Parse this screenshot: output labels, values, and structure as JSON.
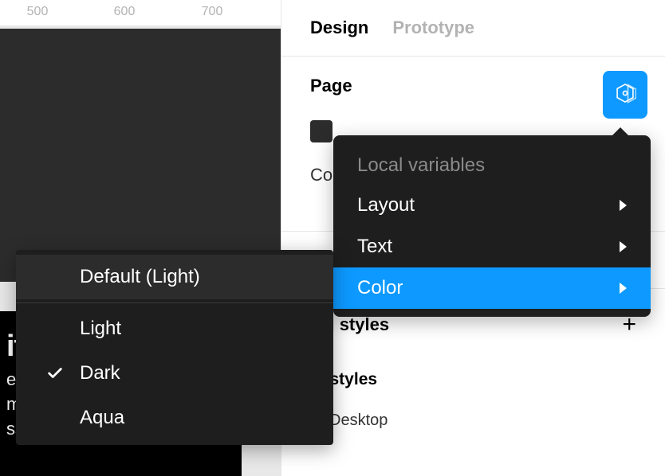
{
  "ruler": {
    "ticks": [
      "500",
      "600",
      "700"
    ]
  },
  "canvas_text": {
    "title_fragment": "it",
    "line1": "en",
    "line2": "m",
    "line3": "ssim cursus."
  },
  "tabs": {
    "design": "Design",
    "prototype": "Prototype"
  },
  "page_section": {
    "title": "Page",
    "color_label_fragment": "Co"
  },
  "local_styles": {
    "title_fragment": "cal styles",
    "text_styles_fragment": "xt styles",
    "item1": "Desktop"
  },
  "vars_menu": {
    "header": "Local variables",
    "layout": "Layout",
    "text": "Text",
    "color": "Color"
  },
  "modes_menu": {
    "default": "Default (Light)",
    "light": "Light",
    "dark": "Dark",
    "aqua": "Aqua",
    "checked": "dark"
  }
}
